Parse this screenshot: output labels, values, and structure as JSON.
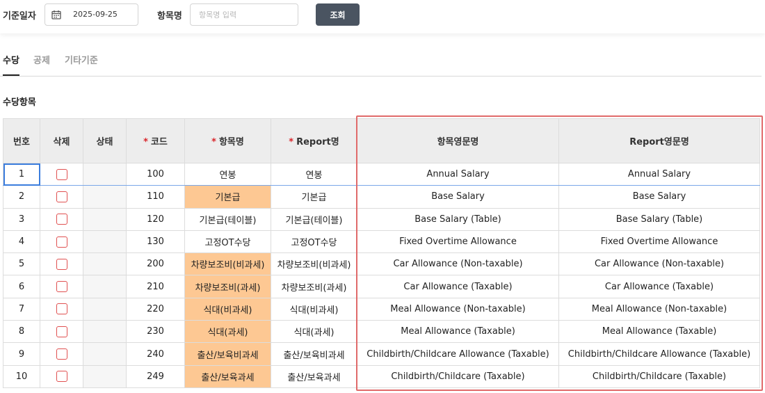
{
  "filter": {
    "date_label": "기준일자",
    "date_value": "2025-09-25",
    "name_label": "항목명",
    "name_placeholder": "항목명 입력",
    "name_value": "",
    "search_label": "조회"
  },
  "tabs": [
    {
      "label": "수당",
      "active": true
    },
    {
      "label": "공제",
      "active": false
    },
    {
      "label": "기타기준",
      "active": false
    }
  ],
  "section_title": "수당항목",
  "table": {
    "headers": {
      "no": "번호",
      "delete": "삭제",
      "status": "상태",
      "code": "코드",
      "name": "항목명",
      "report": "Report명",
      "name_en": "항목영문명",
      "report_en": "Report영문명"
    },
    "required_mark": "*",
    "rows": [
      {
        "no": "1",
        "code": "100",
        "name": "연봉",
        "report": "연봉",
        "name_en": "Annual Salary",
        "report_en": "Annual Salary",
        "highlight": false,
        "selected": true
      },
      {
        "no": "2",
        "code": "110",
        "name": "기본급",
        "report": "기본급",
        "name_en": "Base Salary",
        "report_en": "Base Salary",
        "highlight": true,
        "selected": false
      },
      {
        "no": "3",
        "code": "120",
        "name": "기본급(테이블)",
        "report": "기본급(테이블)",
        "name_en": "Base Salary (Table)",
        "report_en": "Base Salary (Table)",
        "highlight": false,
        "selected": false
      },
      {
        "no": "4",
        "code": "130",
        "name": "고정OT수당",
        "report": "고정OT수당",
        "name_en": "Fixed Overtime Allowance",
        "report_en": "Fixed Overtime Allowance",
        "highlight": false,
        "selected": false
      },
      {
        "no": "5",
        "code": "200",
        "name": "차량보조비(비과세)",
        "report": "차량보조비(비과세)",
        "name_en": "Car Allowance (Non-taxable)",
        "report_en": "Car Allowance (Non-taxable)",
        "highlight": true,
        "selected": false
      },
      {
        "no": "6",
        "code": "210",
        "name": "차량보조비(과세)",
        "report": "차량보조비(과세)",
        "name_en": "Car Allowance (Taxable)",
        "report_en": "Car Allowance (Taxable)",
        "highlight": true,
        "selected": false
      },
      {
        "no": "7",
        "code": "220",
        "name": "식대(비과세)",
        "report": "식대(비과세)",
        "name_en": "Meal Allowance (Non-taxable)",
        "report_en": "Meal Allowance (Non-taxable)",
        "highlight": true,
        "selected": false
      },
      {
        "no": "8",
        "code": "230",
        "name": "식대(과세)",
        "report": "식대(과세)",
        "name_en": "Meal Allowance (Taxable)",
        "report_en": "Meal Allowance (Taxable)",
        "highlight": true,
        "selected": false
      },
      {
        "no": "9",
        "code": "240",
        "name": "출산/보육비과세",
        "report": "출산/보육비과세",
        "name_en": "Childbirth/Childcare Allowance (Taxable)",
        "report_en": "Childbirth/Childcare Allowance (Taxable)",
        "highlight": true,
        "selected": false
      },
      {
        "no": "10",
        "code": "249",
        "name": "출산/보육과세",
        "report": "출산/보육과세",
        "name_en": "Childbirth/Childcare (Taxable)",
        "report_en": "Childbirth/Childcare (Taxable)",
        "highlight": true,
        "selected": false
      }
    ]
  },
  "colors": {
    "highlight_cell": "#fdc893",
    "callout_border": "#e06a6a",
    "required_mark": "#d9262c",
    "checkbox_border": "#e05050",
    "search_button": "#4a5461"
  },
  "icons": {
    "date": "calendar-icon",
    "delete_checkbox": "checkbox-icon"
  }
}
